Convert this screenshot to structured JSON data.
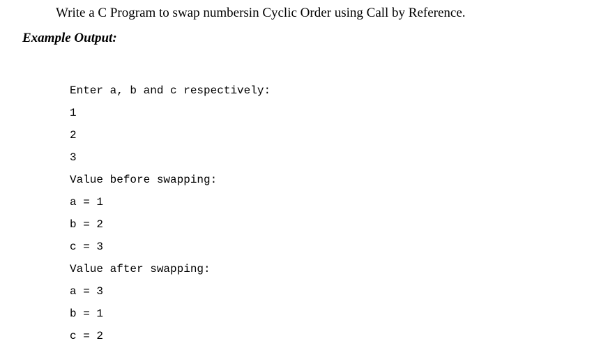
{
  "title": "Write a C Program to swap numbersin Cyclic Order using Call by Reference.",
  "example_label": "Example Output:",
  "output": {
    "prompt": "Enter a, b and c respectively:",
    "inputs": [
      "1",
      "2",
      "3"
    ],
    "before_label": "Value before swapping:",
    "before": {
      "a": "a = 1",
      "b": "b = 2",
      "c": "c = 3"
    },
    "after_label": "Value after swapping:",
    "after": {
      "a": "a = 3",
      "b": "b = 1",
      "c": "c = 2"
    }
  }
}
